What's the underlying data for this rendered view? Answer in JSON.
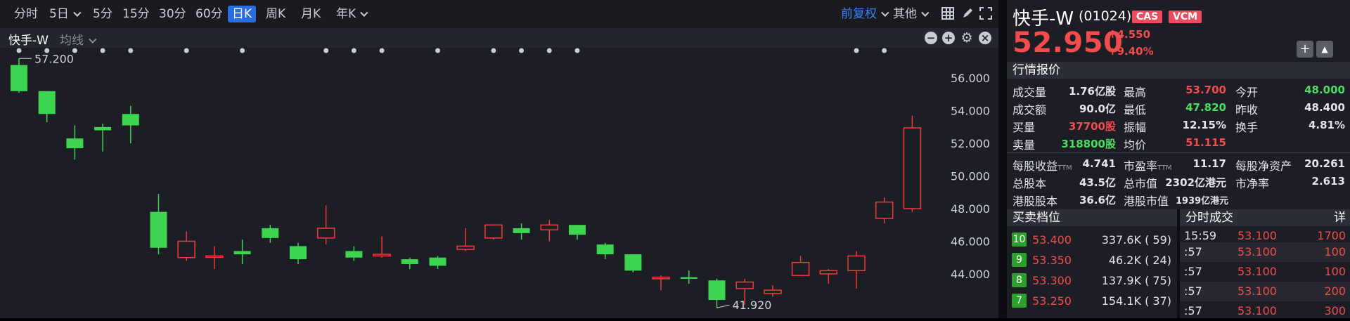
{
  "toolbar": {
    "periods": [
      "分时",
      "5日",
      "5分",
      "15分",
      "30分",
      "60分",
      "日K",
      "周K",
      "月K",
      "年K"
    ],
    "active_period": "日K",
    "adjust_label": "前复权",
    "other_label": "其他"
  },
  "chart_header": {
    "stock_tab": "快手-W",
    "ma_label": "均线"
  },
  "chart_data": {
    "type": "candlestick",
    "y_ticks": [
      "56.000",
      "54.000",
      "52.000",
      "50.000",
      "48.000",
      "46.000",
      "44.000"
    ],
    "y_tick_values": [
      56,
      54,
      52,
      50,
      48,
      46,
      44
    ],
    "ylim": [
      41.5,
      57.6
    ],
    "high_label": "57.200",
    "low_label": "41.920",
    "candles": [
      {
        "o": 56.8,
        "h": 57.2,
        "l": 55.1,
        "c": 55.2,
        "color": "green"
      },
      {
        "o": 55.2,
        "h": 55.2,
        "l": 53.3,
        "c": 53.8,
        "color": "green"
      },
      {
        "o": 52.3,
        "h": 53.1,
        "l": 51.0,
        "c": 51.7,
        "color": "green"
      },
      {
        "o": 53.0,
        "h": 53.2,
        "l": 51.5,
        "c": 52.8,
        "color": "green"
      },
      {
        "o": 53.8,
        "h": 54.3,
        "l": 52.0,
        "c": 53.1,
        "color": "green"
      },
      {
        "o": 47.8,
        "h": 48.9,
        "l": 45.2,
        "c": 45.6,
        "color": "green"
      },
      {
        "o": 45.0,
        "h": 46.6,
        "l": 44.8,
        "c": 46.0,
        "color": "red"
      },
      {
        "o": 45.1,
        "h": 45.7,
        "l": 44.3,
        "c": 45.1,
        "color": "red"
      },
      {
        "o": 45.4,
        "h": 46.1,
        "l": 44.6,
        "c": 45.2,
        "color": "green"
      },
      {
        "o": 46.8,
        "h": 47.0,
        "l": 45.9,
        "c": 46.2,
        "color": "green"
      },
      {
        "o": 45.7,
        "h": 45.9,
        "l": 44.6,
        "c": 44.9,
        "color": "green"
      },
      {
        "o": 46.2,
        "h": 48.2,
        "l": 45.8,
        "c": 46.8,
        "color": "red"
      },
      {
        "o": 45.4,
        "h": 45.7,
        "l": 44.8,
        "c": 45.0,
        "color": "green"
      },
      {
        "o": 45.1,
        "h": 46.3,
        "l": 45.0,
        "c": 45.2,
        "color": "red"
      },
      {
        "o": 44.9,
        "h": 45.0,
        "l": 44.3,
        "c": 44.6,
        "color": "green"
      },
      {
        "o": 45.0,
        "h": 45.1,
        "l": 44.3,
        "c": 44.5,
        "color": "green"
      },
      {
        "o": 45.5,
        "h": 46.8,
        "l": 45.4,
        "c": 45.7,
        "color": "red"
      },
      {
        "o": 46.2,
        "h": 47.0,
        "l": 46.1,
        "c": 47.0,
        "color": "red"
      },
      {
        "o": 46.8,
        "h": 47.1,
        "l": 46.1,
        "c": 46.5,
        "color": "green"
      },
      {
        "o": 46.7,
        "h": 47.3,
        "l": 46.0,
        "c": 47.0,
        "color": "red"
      },
      {
        "o": 47.0,
        "h": 47.0,
        "l": 46.1,
        "c": 46.4,
        "color": "green"
      },
      {
        "o": 45.8,
        "h": 45.9,
        "l": 44.9,
        "c": 45.2,
        "color": "green"
      },
      {
        "o": 45.2,
        "h": 45.2,
        "l": 44.1,
        "c": 44.2,
        "color": "green"
      },
      {
        "o": 43.7,
        "h": 43.9,
        "l": 43.0,
        "c": 43.8,
        "color": "red"
      },
      {
        "o": 43.8,
        "h": 44.2,
        "l": 43.4,
        "c": 43.7,
        "color": "green"
      },
      {
        "o": 43.6,
        "h": 43.7,
        "l": 41.92,
        "c": 42.4,
        "color": "green"
      },
      {
        "o": 43.1,
        "h": 43.7,
        "l": 42.1,
        "c": 43.5,
        "color": "red"
      },
      {
        "o": 42.8,
        "h": 43.3,
        "l": 42.6,
        "c": 43.0,
        "color": "red"
      },
      {
        "o": 43.9,
        "h": 45.1,
        "l": 43.9,
        "c": 44.7,
        "color": "red"
      },
      {
        "o": 44.0,
        "h": 44.3,
        "l": 43.4,
        "c": 44.2,
        "color": "red"
      },
      {
        "o": 44.2,
        "h": 45.4,
        "l": 43.1,
        "c": 45.1,
        "color": "red"
      },
      {
        "o": 47.4,
        "h": 48.7,
        "l": 47.1,
        "c": 48.4,
        "color": "red"
      },
      {
        "o": 48.0,
        "h": 53.7,
        "l": 47.8,
        "c": 52.95,
        "color": "red"
      }
    ],
    "dot_candles": [
      0,
      1,
      2,
      3,
      4,
      6,
      8,
      11,
      12,
      13,
      15,
      17,
      18,
      19,
      20,
      30,
      31
    ]
  },
  "quote": {
    "name": "快手-W",
    "code": "(01024)",
    "badges": [
      "CAS",
      "VCM"
    ],
    "price": "52.950",
    "change": "4.550",
    "change_pct": "+9.40%",
    "section_title": "行情报价",
    "stats": {
      "volume_lbl": "成交量",
      "volume": "1.76亿股",
      "high_lbl": "最高",
      "high": "53.700",
      "open_lbl": "今开",
      "open": "48.000",
      "turnover_lbl": "成交额",
      "turnover": "90.0亿",
      "low_lbl": "最低",
      "low": "47.820",
      "prev_lbl": "昨收",
      "prev": "48.400",
      "bid_lbl": "买量",
      "bid": "37700股",
      "amp_lbl": "振幅",
      "amp": "12.15%",
      "turnrate_lbl": "换手",
      "turnrate": "4.81%",
      "ask_lbl": "卖量",
      "ask": "318800股",
      "avg_lbl": "均价",
      "avg": "51.115",
      "eps_lbl": "每股收益",
      "eps_sub": "TTM",
      "eps": "4.741",
      "pe_lbl": "市盈率",
      "pe_sub": "TTM",
      "pe": "11.17",
      "bvps_lbl": "每股净资产",
      "bvps": "20.261",
      "shares_lbl": "总股本",
      "shares": "43.5亿",
      "mcap_lbl": "总市值",
      "mcap": "2302亿港元",
      "pb_lbl": "市净率",
      "pb": "2.613",
      "hkshares_lbl": "港股股本",
      "hkshares": "36.6亿",
      "hkmcap_lbl": "港股市值",
      "hkmcap": "1939亿港元"
    },
    "orderbook_title": "买卖档位",
    "orderbook": [
      {
        "level": "10",
        "price": "53.400",
        "vol": "337.6K ( 59)"
      },
      {
        "level": "9",
        "price": "53.350",
        "vol": "46.2K ( 24)"
      },
      {
        "level": "8",
        "price": "53.300",
        "vol": "137.9K ( 75)"
      },
      {
        "level": "7",
        "price": "53.250",
        "vol": "154.1K ( 37)"
      }
    ],
    "trades_title": "分时成交",
    "trades_detail": "详",
    "trades": [
      {
        "time": "15:59",
        "price": "53.100",
        "vol": "1700"
      },
      {
        "time": ":57",
        "price": "53.100",
        "vol": "100"
      },
      {
        "time": ":57",
        "price": "53.100",
        "vol": "100"
      },
      {
        "time": ":57",
        "price": "53.100",
        "vol": "200"
      },
      {
        "time": ":57",
        "price": "53.100",
        "vol": "300"
      }
    ]
  }
}
